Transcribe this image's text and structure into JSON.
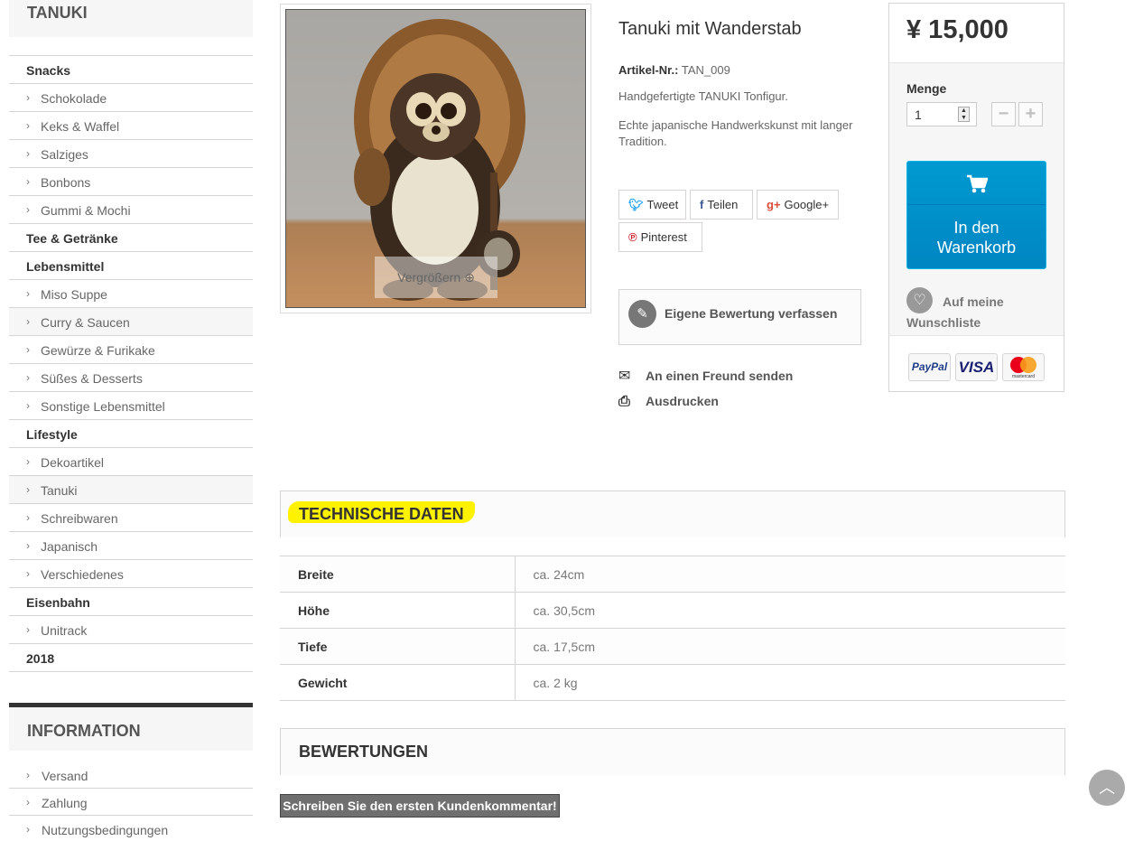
{
  "sidebar": {
    "title": "TANUKI",
    "categories": [
      {
        "label": "Snacks",
        "type": "top"
      },
      {
        "label": "Schokolade",
        "type": "sub"
      },
      {
        "label": "Keks & Waffel",
        "type": "sub"
      },
      {
        "label": "Salziges",
        "type": "sub"
      },
      {
        "label": "Bonbons",
        "type": "sub"
      },
      {
        "label": "Gummi & Mochi",
        "type": "sub"
      },
      {
        "label": "Tee & Getränke",
        "type": "top"
      },
      {
        "label": "Lebensmittel",
        "type": "top"
      },
      {
        "label": "Miso Suppe",
        "type": "sub"
      },
      {
        "label": "Curry & Saucen",
        "type": "sub"
      },
      {
        "label": "Gewürze & Furikake",
        "type": "sub"
      },
      {
        "label": "Süßes & Desserts",
        "type": "sub"
      },
      {
        "label": "Sonstige Lebensmittel",
        "type": "sub"
      },
      {
        "label": "Lifestyle",
        "type": "top"
      },
      {
        "label": "Dekoartikel",
        "type": "sub"
      },
      {
        "label": "Tanuki",
        "type": "sub"
      },
      {
        "label": "Schreibwaren",
        "type": "sub"
      },
      {
        "label": "Japanisch",
        "type": "sub"
      },
      {
        "label": "Verschiedenes",
        "type": "sub"
      },
      {
        "label": "Eisenbahn",
        "type": "top"
      },
      {
        "label": "Unitrack",
        "type": "sub"
      },
      {
        "label": "2018",
        "type": "top"
      }
    ],
    "info_title": "INFORMATION",
    "info_items": [
      "Versand",
      "Zahlung",
      "Nutzungsbedingungen"
    ]
  },
  "product": {
    "title": "Tanuki mit Wanderstab",
    "ref_label": "Artikel-Nr.:",
    "ref_value": "TAN_009",
    "desc1": "Handgefertigte TANUKI Tonfigur.",
    "desc2": "Echte japanische Handwerkskunst mit langer Tradition.",
    "zoom_label": "Vergrößern"
  },
  "social": {
    "tweet": "Tweet",
    "share": "Teilen",
    "google": "Google+",
    "pinterest": "Pinterest"
  },
  "actions": {
    "review": "Eigene Bewertung verfassen",
    "send_friend": "An einen Freund senden",
    "print": "Ausdrucken"
  },
  "buy": {
    "price": "¥ 15,000",
    "qty_label": "Menge",
    "qty_value": "1",
    "minus": "−",
    "plus": "+",
    "cart_label": "In den Warenkorb",
    "wish_line1": "Auf meine",
    "wish_line2": "Wunschliste",
    "pay_logos": [
      "PayPal",
      "VISA",
      "mastercard"
    ]
  },
  "tech": {
    "title": "TECHNISCHE DATEN",
    "rows": [
      {
        "k": "Breite",
        "v": "ca. 24cm"
      },
      {
        "k": "Höhe",
        "v": "ca. 30,5cm"
      },
      {
        "k": "Tiefe",
        "v": "ca. 17,5cm"
      },
      {
        "k": "Gewicht",
        "v": "ca. 2 kg"
      }
    ]
  },
  "reviews": {
    "title": "BEWERTUNGEN",
    "first_button": "Schreiben Sie den ersten Kundenkommentar!"
  },
  "colors": {
    "accent_blue": "#0090cc",
    "highlight": "#fff200"
  }
}
